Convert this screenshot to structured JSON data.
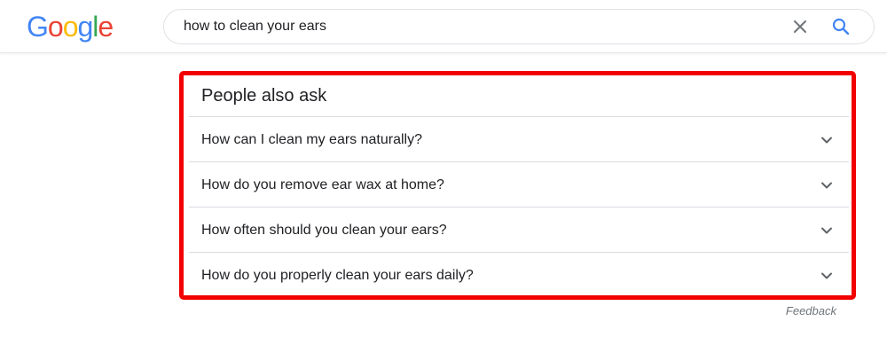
{
  "header": {
    "logo": {
      "letters": [
        "G",
        "o",
        "o",
        "g",
        "l",
        "e"
      ],
      "colors": [
        "#4285f4",
        "#ea4335",
        "#fbbc05",
        "#4285f4",
        "#34a853",
        "#ea4335"
      ]
    },
    "search": {
      "value": "how to clean your ears"
    }
  },
  "people_also_ask": {
    "title": "People also ask",
    "questions": [
      "How can I clean my ears naturally?",
      "How do you remove ear wax at home?",
      "How often should you clean your ears?",
      "How do you properly clean your ears daily?"
    ],
    "highlight_color": "#f20000"
  },
  "feedback_label": "Feedback",
  "icons": {
    "clear": "close-icon",
    "search": "search-icon",
    "expand": "chevron-down-icon"
  }
}
